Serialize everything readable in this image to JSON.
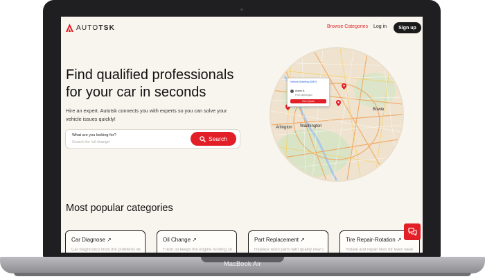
{
  "device": {
    "label": "MacBook Air"
  },
  "header": {
    "logo_text_light": "AUTO",
    "logo_text_bold": "TSK",
    "nav_categories": "Browse Categories",
    "nav_login": "Log in",
    "signup": "Sign up"
  },
  "hero": {
    "title": "Find qualified professionals for your car in seconds",
    "subtitle": "Hire an expert. Autotsk connects you with experts so you can solve your vehicle issues quickly!",
    "search": {
      "label": "What are you looking for?",
      "placeholder": "Search for 'oil change'",
      "button": "Search"
    }
  },
  "map": {
    "labels": [
      "Arlington",
      "Washington",
      "Bowie"
    ],
    "popup": {
      "header": "Vehicle Detailing (DMV)",
      "name": "Adam A.",
      "location": "From Washington",
      "button": "Get a Quote"
    }
  },
  "categories": {
    "title": "Most popular categories",
    "items": [
      {
        "label": "Car Diagnose ↗",
        "desc": "Car diagnostics finds the problems with your"
      },
      {
        "label": "Oil Change ↗",
        "desc": "Fresh oil keeps the engine running smoothly"
      },
      {
        "label": "Part Replacement ↗",
        "desc": "Replace worn parts with quality new ones"
      },
      {
        "label": "Tire Repair-Rotation ↗",
        "desc": "Rotate and repair tires for even wear"
      }
    ]
  },
  "colors": {
    "accent": "#e21e26",
    "background": "#f8f4ee",
    "dark": "#1a1a1a"
  },
  "icons": [
    "autotsk-logo-icon",
    "search-icon",
    "chat-icon",
    "map-pin-icon"
  ]
}
